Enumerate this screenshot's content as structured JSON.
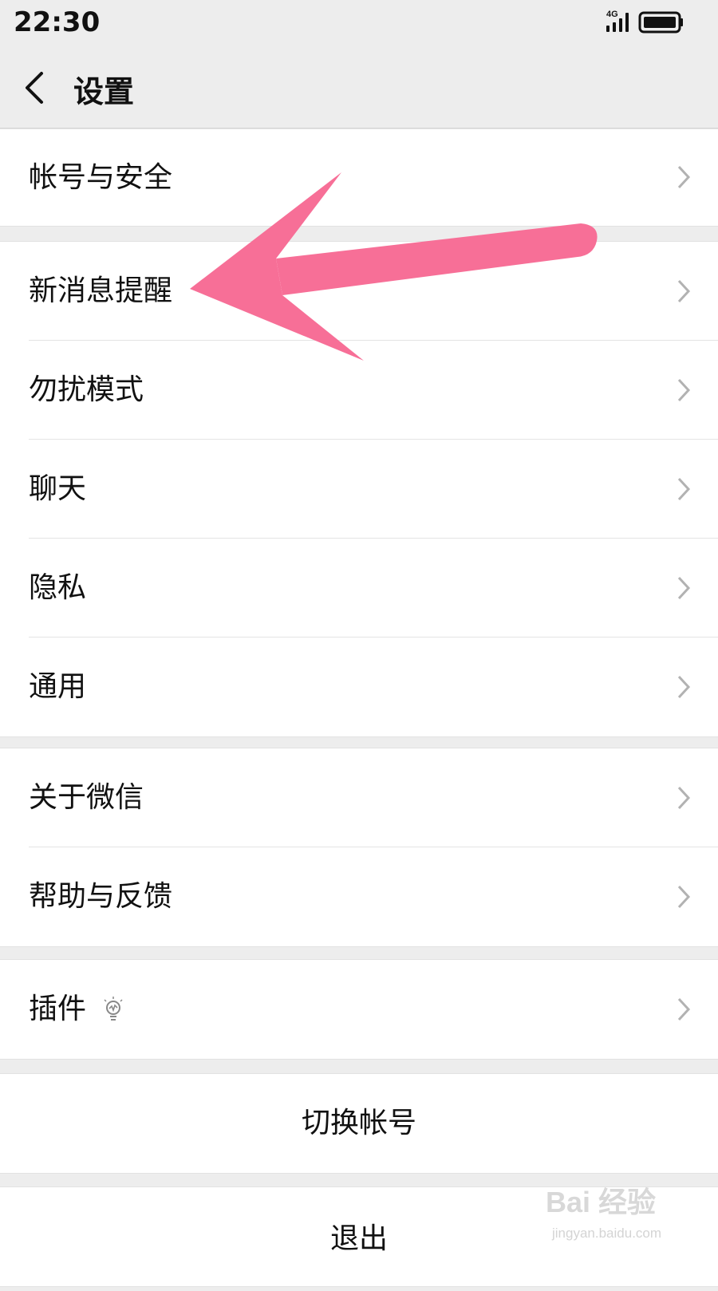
{
  "status_bar": {
    "time": "22:30",
    "network": "4G",
    "icons": [
      "signal-icon",
      "battery-icon"
    ]
  },
  "nav": {
    "title": "设置",
    "back_icon": "chevron-left-icon"
  },
  "groups": [
    {
      "items": [
        {
          "label": "帐号与安全"
        }
      ]
    },
    {
      "items": [
        {
          "label": "新消息提醒"
        },
        {
          "label": "勿扰模式"
        },
        {
          "label": "聊天"
        },
        {
          "label": "隐私"
        },
        {
          "label": "通用"
        }
      ]
    },
    {
      "items": [
        {
          "label": "关于微信"
        },
        {
          "label": "帮助与反馈"
        }
      ]
    },
    {
      "items": [
        {
          "label": "插件",
          "badge_icon": "lightbulb-icon"
        }
      ]
    }
  ],
  "actions": {
    "switch_account": "切换帐号",
    "logout": "退出"
  },
  "annotation": {
    "arrow_color": "#f76f97",
    "points_to": "新消息提醒"
  },
  "watermark": {
    "logo_text": "Bai 经验",
    "sub_text": "jingyan.baidu.com"
  },
  "colors": {
    "background": "#ededed",
    "row_background": "#ffffff",
    "chevron": "#b2b2b2"
  }
}
